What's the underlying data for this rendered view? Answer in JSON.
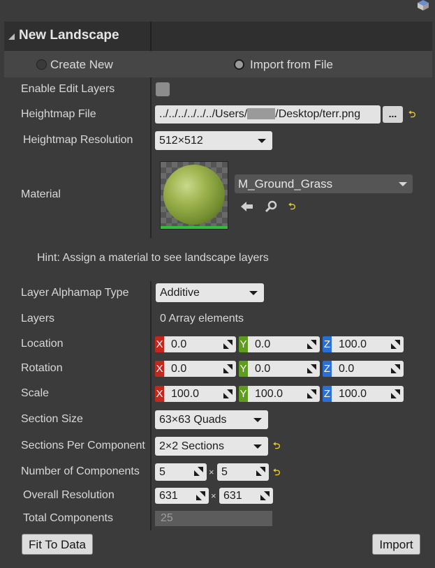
{
  "header": {
    "title": "New Landscape"
  },
  "mode": {
    "create_new": "Create New",
    "import_from_file": "Import from File",
    "selected": "import_from_file"
  },
  "labels": {
    "enable_edit_layers": "Enable Edit Layers",
    "heightmap_file": "Heightmap File",
    "heightmap_resolution": "Heightmap Resolution",
    "material": "Material",
    "layer_alphamap_type": "Layer Alphamap Type",
    "layers": "Layers",
    "location": "Location",
    "rotation": "Rotation",
    "scale": "Scale",
    "section_size": "Section Size",
    "sections_per_component": "Sections Per Component",
    "number_of_components": "Number of Components",
    "overall_resolution": "Overall Resolution",
    "total_components": "Total Components"
  },
  "heightmap": {
    "path_prefix": "../../../../../../Users/",
    "path_suffix": "/Desktop/terr.png",
    "browse_label": "...",
    "resolution": "512×512"
  },
  "material": {
    "name": "M_Ground_Grass"
  },
  "hint": "Hint: Assign a material to see landscape layers",
  "alphamap": {
    "value": "Additive"
  },
  "layers_value": "0 Array elements",
  "axes": {
    "x": "X",
    "y": "Y",
    "z": "Z"
  },
  "location": {
    "x": "0.0",
    "y": "0.0",
    "z": "100.0"
  },
  "rotation": {
    "x": "0.0",
    "y": "0.0",
    "z": "0.0"
  },
  "scale": {
    "x": "100.0",
    "y": "100.0",
    "z": "100.0"
  },
  "section_size": "63×63 Quads",
  "sections_per_component": "2×2 Sections",
  "components": {
    "x": "5",
    "y": "5"
  },
  "overall_resolution": {
    "x": "631",
    "y": "631"
  },
  "total_components": "25",
  "times_symbol": "×",
  "buttons": {
    "fit_to_data": "Fit To Data",
    "import": "Import"
  },
  "colors": {
    "axis_x": "#c4271e",
    "axis_y": "#5e9c1d",
    "axis_z": "#2a6fd6",
    "reset_arrow": "#e6c832"
  }
}
